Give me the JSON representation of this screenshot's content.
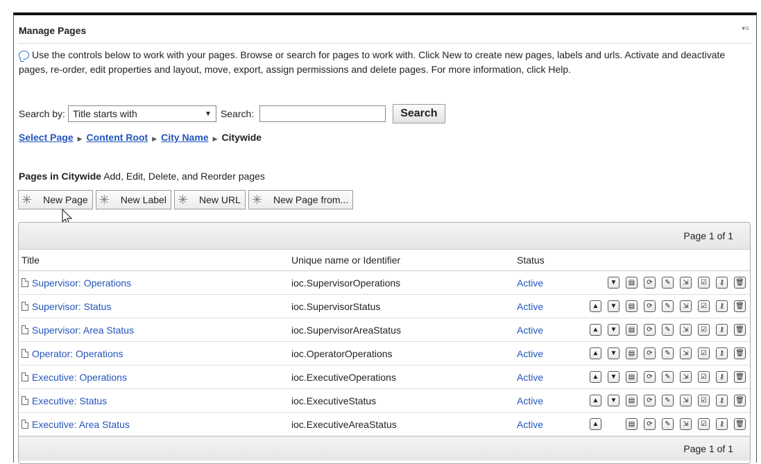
{
  "header": {
    "title": "Manage Pages",
    "menu_glyph": "▾≡"
  },
  "intro": "Use the controls below to work with your pages. Browse or search for pages to work with. Click New to create new pages, labels and urls. Activate and deactivate pages, re-order, edit properties and layout, move, export, assign permissions and delete pages. For more information, click Help.",
  "search": {
    "by_label": "Search by:",
    "by_value": "Title starts with",
    "search_label": "Search:",
    "input_value": "",
    "button": "Search"
  },
  "breadcrumb": {
    "items": [
      "Select Page",
      "Content Root",
      "City Name"
    ],
    "current": "Citywide"
  },
  "pages_in": {
    "prefix": "Pages in",
    "name": "Citywide",
    "desc": "Add, Edit, Delete, and Reorder pages"
  },
  "toolbar": {
    "new_page": "New Page",
    "new_label": "New Label",
    "new_url": "New URL",
    "new_page_from": "New Page from..."
  },
  "table": {
    "pager": "Page 1 of 1",
    "columns": [
      "Title",
      "Unique name or Identifier",
      "Status"
    ],
    "rows": [
      {
        "title": "Supervisor: Operations",
        "id": "ioc.SupervisorOperations",
        "status": "Active"
      },
      {
        "title": "Supervisor: Status",
        "id": "ioc.SupervisorStatus",
        "status": "Active"
      },
      {
        "title": "Supervisor: Area Status",
        "id": "ioc.SupervisorAreaStatus",
        "status": "Active"
      },
      {
        "title": "Operator: Operations",
        "id": "ioc.OperatorOperations",
        "status": "Active"
      },
      {
        "title": "Executive: Operations",
        "id": "ioc.ExecutiveOperations",
        "status": "Active"
      },
      {
        "title": "Executive: Status",
        "id": "ioc.ExecutiveStatus",
        "status": "Active"
      },
      {
        "title": "Executive: Area Status",
        "id": "ioc.ExecutiveAreaStatus",
        "status": "Active"
      }
    ]
  },
  "colors": {
    "link": "#2255bb",
    "accent": "#2a6fc9"
  }
}
